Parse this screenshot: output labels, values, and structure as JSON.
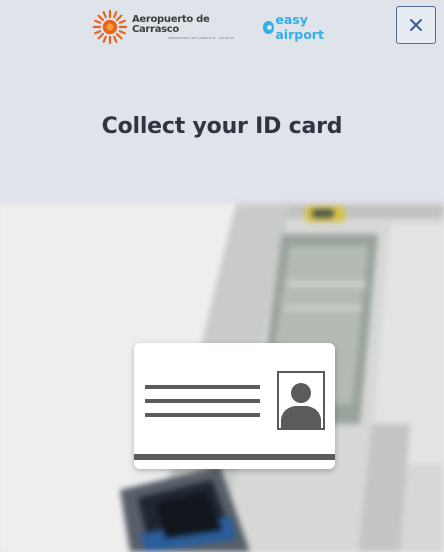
{
  "header": {
    "airport_logo_name": "Aeropuerto de Carrasco",
    "airport_logo_subtitle": "AEROPUERTO DE CARRASCO · URUGUAY",
    "airport_logo_color": "#e8641b",
    "partner_logo_name": "easy airport",
    "partner_logo_color": "#33aee8",
    "close_icon": "close-icon"
  },
  "main": {
    "title": "Collect your ID card"
  },
  "illustration": {
    "kiosk": "kiosk-machine-illustration",
    "card_icon": "id-card-icon",
    "photo_icon": "person-silhouette-icon"
  },
  "colors": {
    "header_background": "#dfe3ea",
    "title_text": "#2f3640",
    "close_button_border": "#4d6c98"
  }
}
